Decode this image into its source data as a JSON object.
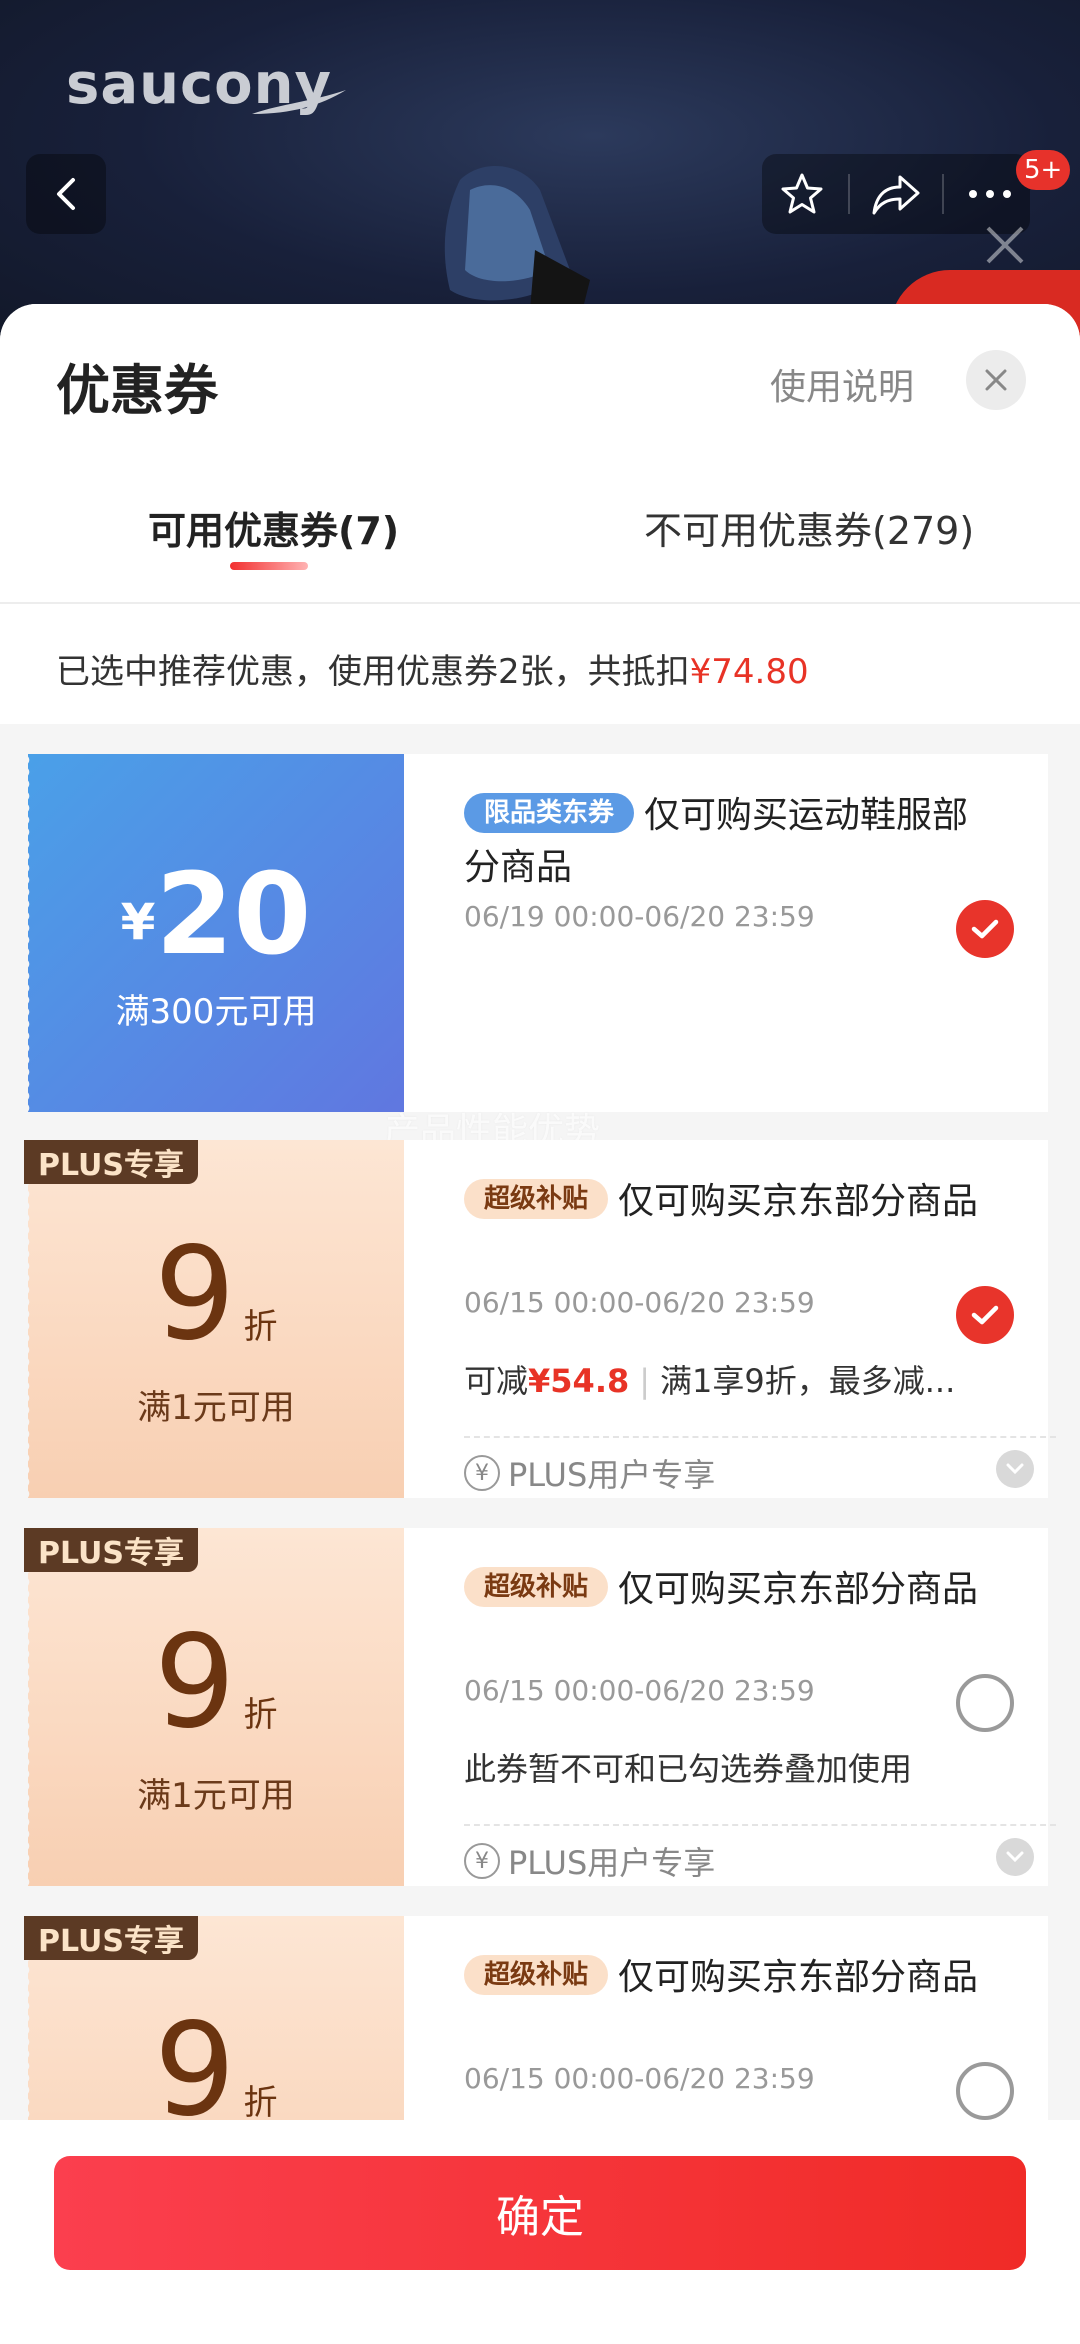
{
  "background": {
    "brand": "saucony",
    "cart_badge": "5+"
  },
  "sheet": {
    "title": "优惠券",
    "help_link": "使用说明",
    "tabs": [
      {
        "label": "可用优惠券(7)",
        "active": true
      },
      {
        "label": "不可用优惠券(279)",
        "active": false
      }
    ],
    "summary_prefix": "已选中推荐优惠，使用优惠券2张，共抵扣",
    "summary_amount": "¥74.80"
  },
  "coupons": [
    {
      "type": "amount",
      "currency": "¥",
      "value": "20",
      "condition": "满300元可用",
      "badge": "限品类东券",
      "name": "仅可购买运动鞋服部分商品",
      "date": "06/19 00:00-06/20 23:59",
      "selected": true
    },
    {
      "type": "discount",
      "plus_tag": "PLUS专享",
      "value": "9",
      "unit": "折",
      "condition": "满1元可用",
      "badge": "超级补贴",
      "name": "仅可购买京东部分商品",
      "date": "06/15 00:00-06/20 23:59",
      "selected": true,
      "note_prefix": "可减",
      "note_amount": "¥54.8",
      "note_suffix": "满1享9折，最多减...",
      "plus_row": "PLUS用户专享"
    },
    {
      "type": "discount",
      "plus_tag": "PLUS专享",
      "value": "9",
      "unit": "折",
      "condition": "满1元可用",
      "badge": "超级补贴",
      "name": "仅可购买京东部分商品",
      "date": "06/15 00:00-06/20 23:59",
      "selected": false,
      "note": "此券暂不可和已勾选券叠加使用",
      "plus_row": "PLUS用户专享"
    },
    {
      "type": "discount",
      "plus_tag": "PLUS专享",
      "value": "9",
      "unit": "折",
      "badge": "超级补贴",
      "name": "仅可购买京东部分商品",
      "date": "06/15 00:00-06/20 23:59",
      "selected": false
    }
  ],
  "watermark": "产品性能优势",
  "confirm_label": "确定",
  "colors": {
    "accent_red": "#e8342b",
    "plus_brown": "#5c3a24"
  }
}
